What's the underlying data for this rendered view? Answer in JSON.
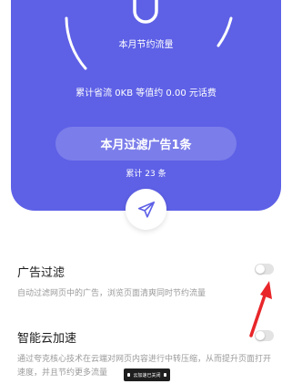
{
  "stats": {
    "saved_label": "本月节约流量",
    "total_saved": "累计省流 0KB 等值约 0.00 元话费",
    "month_filtered": "本月过滤广告1条",
    "total_filtered": "累计 23 条"
  },
  "settings": [
    {
      "title": "广告过滤",
      "description": "自动过滤网页中的广告，浏览页面清爽同时节约流量",
      "enabled": false
    },
    {
      "title": "智能云加速",
      "description": "通过夸克核心技术在云端对网页内容进行中转压缩，从而提升页面打开速度，并且节约更多流量",
      "enabled": false
    }
  ],
  "toast": {
    "text": "云加速已关闭"
  },
  "colors": {
    "primary": "#5e61e6",
    "annotation_arrow": "#e8262a"
  },
  "icons": {
    "share": "paper-plane-icon"
  }
}
